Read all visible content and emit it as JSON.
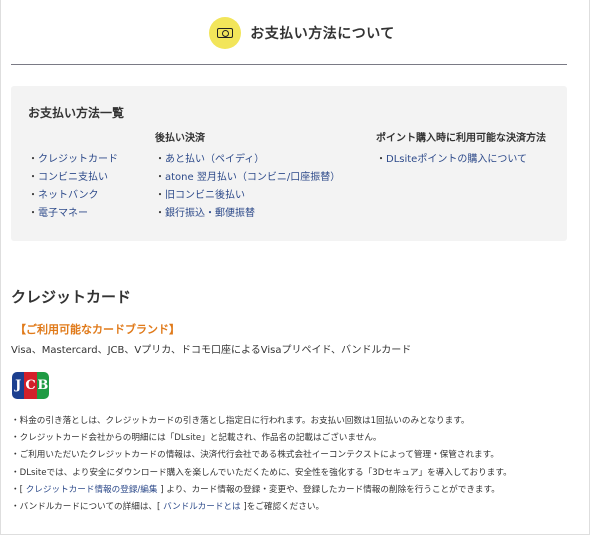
{
  "header": {
    "title": "お支払い方法について",
    "icon": "money-icon",
    "badge_color": "#f2e55a"
  },
  "summary": {
    "title": "お支払い方法一覧",
    "columns": [
      {
        "heading": "",
        "items": [
          "クレジットカード",
          "コンビニ支払い",
          "ネットバンク",
          "電子マネー"
        ]
      },
      {
        "heading": "後払い決済",
        "items": [
          "あと払い（ペイディ）",
          "atone 翌月払い（コンビニ/口座振替）",
          "旧コンビニ後払い",
          "銀行振込・郵便振替"
        ]
      },
      {
        "heading": "ポイント購入時に利用可能な決済方法",
        "items": [
          "DLsiteポイントの購入について"
        ]
      }
    ],
    "bullet": "・"
  },
  "credit_card": {
    "section_title": "クレジットカード",
    "brand_heading": "【ご利用可能なカードブランド】",
    "brand_list": "Visa、Mastercard、JCB、Vプリカ、ドコモ口座によるVisaプリペイド、バンドルカード",
    "logo_letters": [
      "J",
      "C",
      "B"
    ],
    "notes": {
      "n1": "・料金の引き落としは、クレジットカードの引き落とし指定日に行われます。お支払い回数は1回払いのみとなります。",
      "n2": "・クレジットカード会社からの明細には「DLsite」と記載され、作品名の記載はございません。",
      "n3": "・ご利用いただいたクレジットカードの情報は、決済代行会社である株式会社イーコンテクストによって管理・保管されます。",
      "n4": "・DLsiteでは、より安全にダウンロード購入を楽しんでいただくために、安全性を強化する「3Dセキュア」を導入しております。",
      "n5_pre": "・[ ",
      "n5_link": "クレジットカード情報の登録/編集",
      "n5_post": " ] より、カード情報の登録・変更や、登録したカード情報の削除を行うことができます。",
      "n6_pre": "・バンドルカードについての詳細は、[ ",
      "n6_link": "バンドルカードとは",
      "n6_post": " ]をご確認ください。"
    }
  },
  "colors": {
    "link": "#2d4a8a",
    "accent_orange": "#e07a1a",
    "summary_bg": "#f3f3f3"
  }
}
